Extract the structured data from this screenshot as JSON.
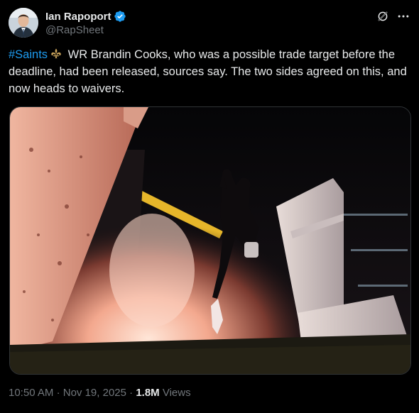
{
  "author": {
    "display_name": "Ian Rapoport",
    "handle": "@RapSheet",
    "verified": true,
    "verified_color": "#1d9bf0"
  },
  "tweet": {
    "hashtag": "#Saints",
    "emoji_icon": "fleur-de-lis-icon",
    "body": " WR Brandin Cooks, who was a possible trade target before the deadline, had been released, sources say. The two sides agreed on this, and now heads to waivers."
  },
  "media": {
    "alt_icon": "football-player-tunnel-photo"
  },
  "meta": {
    "time": "10:50 AM",
    "separator": "·",
    "date": "Nov 19, 2025",
    "views_count": "1.8M",
    "views_label": "Views"
  },
  "colors": {
    "background": "#000000",
    "text": "#e7e9ea",
    "secondary": "#71767b",
    "link": "#1d9bf0"
  }
}
